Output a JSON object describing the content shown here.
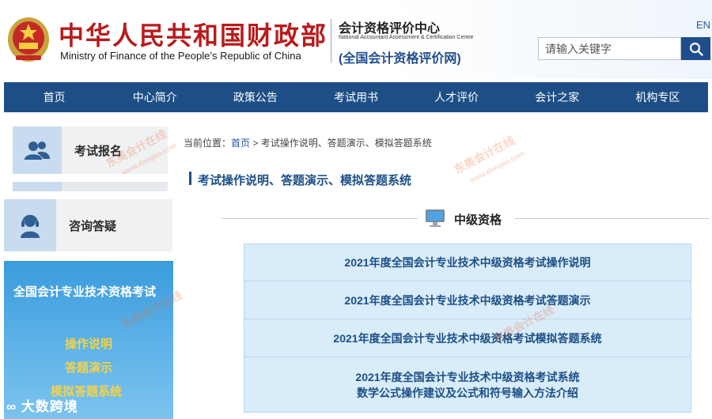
{
  "header": {
    "title_cn": "中华人民共和国财政部",
    "title_en": "Ministry of Finance of the People’s Republic of China",
    "center_cn": "会计资格评价中心",
    "center_en": "National Accountant Assessment & Certification Centre",
    "center_web": "(全国会计资格评价网)",
    "lang": "EN",
    "search_placeholder": "请输入关键字"
  },
  "nav": {
    "items": [
      "首页",
      "中心简介",
      "政策公告",
      "考试用书",
      "人才评价",
      "会计之家",
      "机构专区"
    ]
  },
  "sidebar": {
    "register_label": "考试报名",
    "consult_label": "咨询答疑",
    "exam_title": "全国会计专业技术资格考试",
    "links": [
      "操作说明",
      "答题演示",
      "模拟答题系统"
    ],
    "brand": "大数跨境"
  },
  "content": {
    "breadcrumb_prefix": "当前位置：",
    "breadcrumb_home": "首页",
    "breadcrumb_sep": " > ",
    "breadcrumb_current": "考试操作说明、答题演示、模拟答题系统",
    "page_title": "考试操作说明、答题演示、模拟答题系统",
    "section_title": "中级资格",
    "links": [
      "2021年度全国会计专业技术中级资格考试操作说明",
      "2021年度全国会计专业技术中级资格考试答题演示",
      "2021年度全国会计专业技术中级资格考试模拟答题系统"
    ],
    "link4_line1": "2021年度全国会计专业技术中级资格考试系统",
    "link4_line2": "数学公式操作建议及公式和符号输入方法介绍"
  },
  "watermarks": [
    "东奥会计在线",
    "www.dongao.com"
  ],
  "colors": {
    "nav_bg": "#1d4f86",
    "title_red": "#b71c1c",
    "link_blue": "#1d4f86",
    "panel_blue": "#3a9bdc",
    "link_yellow": "#f3d24a"
  }
}
